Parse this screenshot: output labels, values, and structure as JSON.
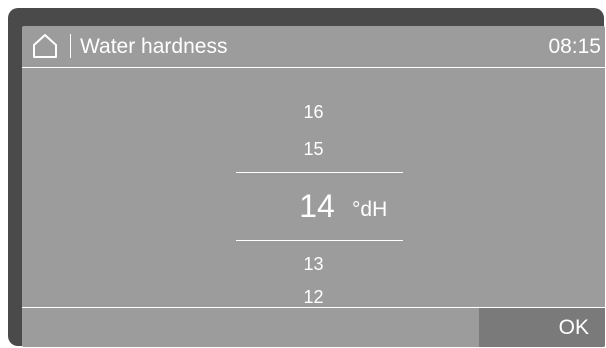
{
  "header": {
    "title": "Water hardness",
    "time": "08:15",
    "home_icon": "home-icon"
  },
  "picker": {
    "above": [
      "16",
      "15"
    ],
    "selected": "14",
    "unit": "°dH",
    "below": [
      "13",
      "12"
    ]
  },
  "footer": {
    "ok_label": "OK"
  },
  "colors": {
    "screen": "#9c9c9c",
    "frame": "#4a4a4a",
    "ok_button": "#7a7a7a",
    "text": "#ffffff"
  }
}
